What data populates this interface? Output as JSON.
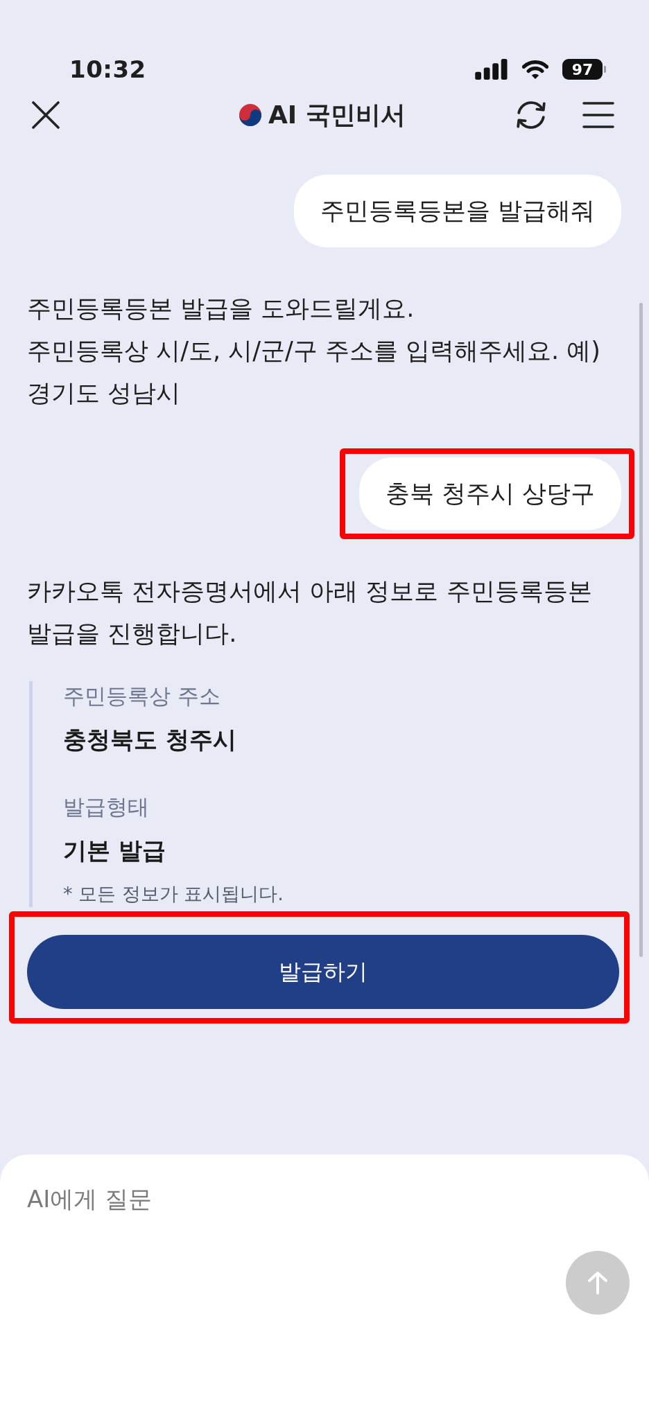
{
  "status_bar": {
    "time": "10:32",
    "battery": "97"
  },
  "header": {
    "title": "AI 국민비서"
  },
  "conversation": [
    {
      "kind": "user",
      "text": "주민등록등본을 발급해줘",
      "highlighted": false
    },
    {
      "kind": "bot",
      "paragraphs": [
        "주민등록등본 발급을 도와드릴게요.",
        "주민등록상 시/도, 시/군/구 주소를 입력해주세요. 예) 경기도 성남시"
      ],
      "highlighted": false
    },
    {
      "kind": "user",
      "text": "충북 청주시 상당구",
      "highlighted": true
    },
    {
      "kind": "bot",
      "paragraphs": [
        "카카오톡 전자증명서에서 아래 정보로 주민등록등본 발급을 진행합니다."
      ],
      "highlighted": false
    }
  ],
  "summary": {
    "fields": [
      {
        "label": "주민등록상 주소",
        "value": "충청북도 청주시"
      },
      {
        "label": "발급형태",
        "value": "기본 발급"
      }
    ],
    "note": "* 모든 정보가 표시됩니다."
  },
  "action_button": {
    "label": "발급하기",
    "highlighted": true
  },
  "composer": {
    "placeholder": "AI에게 질문"
  }
}
